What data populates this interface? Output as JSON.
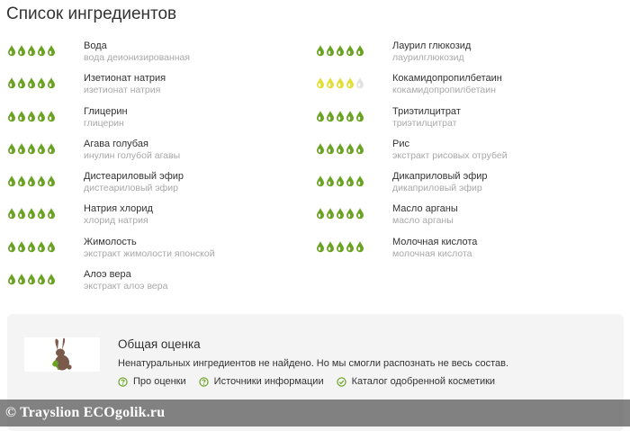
{
  "page": {
    "title": "Список ингредиентов"
  },
  "colors": {
    "green": "#6aa222",
    "yellow": "#e2df38",
    "faded": "#e2e2e2"
  },
  "ingredients": [
    {
      "name": "Вода",
      "sub": "вода деионизированная",
      "rating": 5,
      "color": "green"
    },
    {
      "name": "Изетионат натрия",
      "sub": "изетионат натрия",
      "rating": 5,
      "color": "green"
    },
    {
      "name": "Глицерин",
      "sub": "глицерин",
      "rating": 5,
      "color": "green"
    },
    {
      "name": "Агава голубая",
      "sub": "инулин голубой агавы",
      "rating": 5,
      "color": "green"
    },
    {
      "name": "Дистеариловый эфир",
      "sub": "дистеариловый эфир",
      "rating": 5,
      "color": "green"
    },
    {
      "name": "Натрия хлорид",
      "sub": "хлорид натрия",
      "rating": 5,
      "color": "green"
    },
    {
      "name": "Жимолость",
      "sub": "экстракт жимолости японской",
      "rating": 5,
      "color": "green"
    },
    {
      "name": "Алоэ вера",
      "sub": "экстракт алоэ вера",
      "rating": 5,
      "color": "green"
    },
    {
      "name": "Лаурил глюкозид",
      "sub": "лаурилглюкозид",
      "rating": 5,
      "color": "green"
    },
    {
      "name": "Кокамидопропилбетаин",
      "sub": "кокамидопропилбетаин",
      "rating": 4,
      "color": "yellow"
    },
    {
      "name": "Триэтилцитрат",
      "sub": "триэтилцитрат",
      "rating": 5,
      "color": "green"
    },
    {
      "name": "Рис",
      "sub": "экстракт рисовых отрубей",
      "rating": 5,
      "color": "green"
    },
    {
      "name": "Дикаприловый эфир",
      "sub": "дикаприловый эфир",
      "rating": 5,
      "color": "green"
    },
    {
      "name": "Масло арганы",
      "sub": "масло арганы",
      "rating": 5,
      "color": "green"
    },
    {
      "name": "Молочная кислота",
      "sub": "молочная кислота",
      "rating": 5,
      "color": "green"
    }
  ],
  "summary": {
    "title": "Общая оценка",
    "text": "Ненатуральных ингредиентов не найдено. Но мы смогли распознать не весь состав.",
    "logo_icon": "rabbit-logo-icon",
    "links": [
      {
        "label": "Про оценки",
        "icon": "question-icon"
      },
      {
        "label": "Источники информации",
        "icon": "question-icon"
      },
      {
        "label": "Каталог одобренной косметики",
        "icon": "check-icon"
      }
    ]
  },
  "watermark": {
    "text": "© Trayslion ECOgolik.ru"
  }
}
